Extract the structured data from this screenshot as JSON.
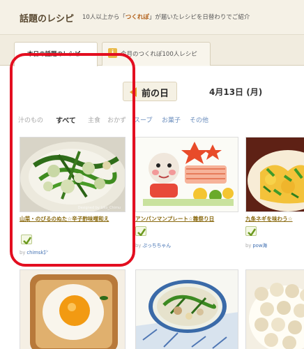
{
  "header": {
    "title": "話題のレシピ",
    "subtitle_pre": "10人以上から「",
    "subtitle_hl": "つくれぽ",
    "subtitle_post": "」が届いたレシピを日替わりでご紹介"
  },
  "tabs": [
    {
      "label": "本日の話題のレシピ",
      "active": true
    },
    {
      "label": "今月のつくれぽ100人レシピ",
      "active": false,
      "icon": "book-icon"
    }
  ],
  "nav": {
    "prev_label": "前の日",
    "date": "4月13日 (月)"
  },
  "categories": [
    {
      "label": "汁のもの",
      "active": false,
      "faded": true
    },
    {
      "label": "すべて",
      "active": true
    },
    {
      "label": "主食",
      "active": false,
      "faded": true
    },
    {
      "label": "おかず",
      "active": false,
      "faded": true
    },
    {
      "label": "スープ",
      "active": false
    },
    {
      "label": "お菓子",
      "active": false
    },
    {
      "label": "その他",
      "active": false
    }
  ],
  "recipes": [
    {
      "title": "山菜・のびるのぬた☆辛子酢味噌和え",
      "author_prefix": "by",
      "author": "chimsk㌢",
      "image": "wild-vegetable-dish",
      "watermark": "Designed by Liko_Chimu"
    },
    {
      "title": "アンパンマンプレート☆雛祭り日",
      "author_prefix": "by",
      "author": "ぷっちちゃん",
      "image": "anpanman-plate"
    },
    {
      "title": "九条ネギを味わう☆",
      "author_prefix": "by",
      "author": "pow海",
      "image": "egg-stirfry"
    },
    {
      "title": "",
      "author": "",
      "image": "egg-toast"
    },
    {
      "title": "",
      "author": "",
      "image": "cream-stew"
    },
    {
      "title": "",
      "author": "",
      "image": "round-dumplings"
    }
  ],
  "colors": {
    "highlight": "#e30e20",
    "link": "#3d6db0",
    "title_link": "#8a6a10",
    "accent": "#e39a2a"
  }
}
